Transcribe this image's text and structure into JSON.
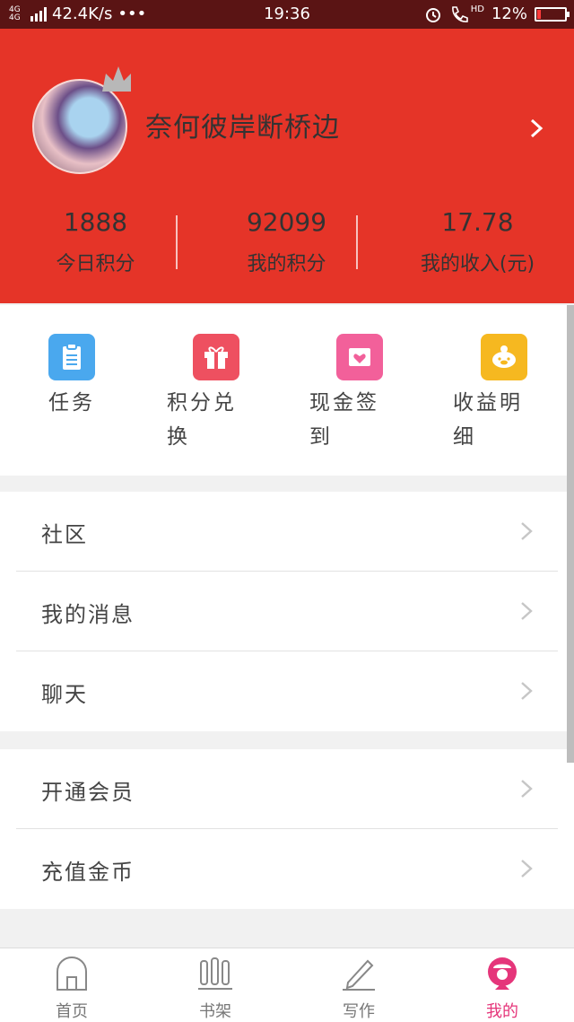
{
  "status_bar": {
    "network": "4G 4G",
    "speed": "42.4K/s",
    "dots": "•••",
    "time": "19:36",
    "hd": "HD",
    "battery": "12%",
    "battery_level": 0.12
  },
  "profile": {
    "username": "奈何彼岸断桥边"
  },
  "stats": [
    {
      "value": "1888",
      "label": "今日积分"
    },
    {
      "value": "92099",
      "label": "我的积分"
    },
    {
      "value": "17.78",
      "label": "我的收入(元)"
    }
  ],
  "quick_actions": [
    {
      "label": "任务",
      "icon": "clipboard-icon",
      "color": "#4aa8ee"
    },
    {
      "label": "积分兑换",
      "icon": "gift-icon",
      "color": "#ee5060"
    },
    {
      "label": "现金签到",
      "icon": "envelope-icon",
      "color": "#f2609a"
    },
    {
      "label": "收益明细",
      "icon": "piggy-bank-icon",
      "color": "#f6b820"
    }
  ],
  "menu_group_1": [
    "社区",
    "我的消息",
    "聊天"
  ],
  "menu_group_2": [
    "开通会员",
    "充值金币"
  ],
  "tabs": [
    {
      "label": "首页",
      "icon": "home-icon"
    },
    {
      "label": "书架",
      "icon": "bookshelf-icon"
    },
    {
      "label": "写作",
      "icon": "pencil-icon"
    },
    {
      "label": "我的",
      "icon": "profile-icon",
      "active": true
    }
  ],
  "colors": {
    "header_red": "#e53428",
    "accent_pink": "#e5357a"
  }
}
